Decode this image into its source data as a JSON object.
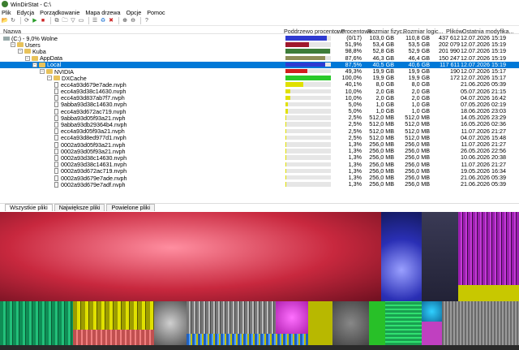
{
  "window": {
    "title": "WinDirStat - C:\\"
  },
  "menu": [
    "Plik",
    "Edycja",
    "Porządkowanie",
    "Mapa drzewa",
    "Opcje",
    "Pomoc"
  ],
  "toolbar_icons": [
    "open-icon",
    "refresh-icon",
    "refresh-all-icon",
    "play-icon",
    "stop-icon",
    "copy-path-icon",
    "explorer-icon",
    "filter-icon",
    "cmd-icon",
    "properties-icon",
    "recycle-icon",
    "delete-icon",
    "zoom-in-icon",
    "zoom-out-icon",
    "help-icon"
  ],
  "columns": {
    "name": "Nazwa",
    "subtree": "Poddrzewo procentowo",
    "percent": "↓ Procentowo",
    "physical": "Rozmiar fizyc...",
    "logical": "Rozmiar logic...",
    "files": "Plików",
    "modified": "Ostatnia modyfika..."
  },
  "rows": [
    {
      "name": "(C:) - 9,0% Wolne",
      "indent": 0,
      "icon": "drive",
      "exp": "",
      "pct": "(0/17)",
      "phys": "103,0 GB",
      "log": "110,8 GB",
      "files": "437 612",
      "date": "12.07.2026 15:19",
      "fill": 0.91,
      "color": "#2f3bd1"
    },
    {
      "name": "Users",
      "indent": 1,
      "icon": "folder",
      "exp": "−",
      "pct": "51,9%",
      "phys": "53,4 GB",
      "log": "53,5 GB",
      "files": "202 079",
      "date": "12.07.2026 15:19",
      "fill": 0.52,
      "color": "#a0192d"
    },
    {
      "name": "Kuba",
      "indent": 2,
      "icon": "folder",
      "exp": "−",
      "pct": "98,8%",
      "phys": "52,8 GB",
      "log": "52,9 GB",
      "files": "201 990",
      "date": "12.07.2026 15:19",
      "fill": 0.99,
      "color": "#3e7d3a"
    },
    {
      "name": "AppData",
      "indent": 3,
      "icon": "folder",
      "exp": "−",
      "pct": "87,6%",
      "phys": "46,3 GB",
      "log": "46,4 GB",
      "files": "150 247",
      "date": "12.07.2026 15:19",
      "fill": 0.88,
      "color": "#8e8e58"
    },
    {
      "name": "Local",
      "indent": 4,
      "icon": "folder",
      "exp": "−",
      "pct": "87,5%",
      "phys": "40,5 GB",
      "log": "40,6 GB",
      "files": "117 611",
      "date": "12.07.2026 15:19",
      "fill": 0.88,
      "color": "#2f3bd1",
      "selected": true
    },
    {
      "name": "NVIDIA",
      "indent": 5,
      "icon": "folder",
      "exp": "−",
      "pct": "49,3%",
      "phys": "19,9 GB",
      "log": "19,9 GB",
      "files": "190",
      "date": "12.07.2026 15:17",
      "fill": 0.49,
      "color": "#d21d1d"
    },
    {
      "name": "DXCache",
      "indent": 6,
      "icon": "folder",
      "exp": "−",
      "pct": "100,0%",
      "phys": "19,9 GB",
      "log": "19,9 GB",
      "files": "172",
      "date": "12.07.2026 15:17",
      "fill": 1.0,
      "color": "#2ac92a"
    },
    {
      "name": "ecc4a93d679e7ade.nvph",
      "indent": 7,
      "icon": "file",
      "exp": "",
      "pct": "40,1%",
      "phys": "8,0 GB",
      "log": "8,0 GB",
      "files": "",
      "date": "21.06.2026 05:39",
      "fill": 0.4,
      "color": "#e0e000"
    },
    {
      "name": "ecc4a93d38c14630.nvph",
      "indent": 7,
      "icon": "file",
      "exp": "",
      "pct": "10,0%",
      "phys": "2,0 GB",
      "log": "2,0 GB",
      "files": "",
      "date": "05.07.2026 21:15",
      "fill": 0.1,
      "color": "#e0e000"
    },
    {
      "name": "ecc4a93d837ab7f7.nvph",
      "indent": 7,
      "icon": "file",
      "exp": "",
      "pct": "10,0%",
      "phys": "2,0 GB",
      "log": "2,0 GB",
      "files": "",
      "date": "04.07.2026 16:42",
      "fill": 0.1,
      "color": "#e0e000"
    },
    {
      "name": "9abba93d38c14630.nvph",
      "indent": 7,
      "icon": "file",
      "exp": "",
      "pct": "5,0%",
      "phys": "1,0 GB",
      "log": "1,0 GB",
      "files": "",
      "date": "07.05.2026 02:19",
      "fill": 0.05,
      "color": "#e0e000"
    },
    {
      "name": "ecc4a93d672ac719.nvph",
      "indent": 7,
      "icon": "file",
      "exp": "",
      "pct": "5,0%",
      "phys": "1,0 GB",
      "log": "1,0 GB",
      "files": "",
      "date": "18.06.2026 23:03",
      "fill": 0.05,
      "color": "#e0e000"
    },
    {
      "name": "9abba93d05f93a21.nvph",
      "indent": 7,
      "icon": "file",
      "exp": "",
      "pct": "2,5%",
      "phys": "512,0 MB",
      "log": "512,0 MB",
      "files": "",
      "date": "14.05.2026 23:29",
      "fill": 0.025,
      "color": "#e0e000"
    },
    {
      "name": "9abba93db29364b4.nvph",
      "indent": 7,
      "icon": "file",
      "exp": "",
      "pct": "2,5%",
      "phys": "512,0 MB",
      "log": "512,0 MB",
      "files": "",
      "date": "16.05.2026 02:36",
      "fill": 0.025,
      "color": "#e0e000"
    },
    {
      "name": "ecc4a93d05f93a21.nvph",
      "indent": 7,
      "icon": "file",
      "exp": "",
      "pct": "2,5%",
      "phys": "512,0 MB",
      "log": "512,0 MB",
      "files": "",
      "date": "11.07.2026 21:27",
      "fill": 0.025,
      "color": "#e0e000"
    },
    {
      "name": "ecc4a93d8ed977d1.nvph",
      "indent": 7,
      "icon": "file",
      "exp": "",
      "pct": "2,5%",
      "phys": "512,0 MB",
      "log": "512,0 MB",
      "files": "",
      "date": "04.07.2026 15:48",
      "fill": 0.025,
      "color": "#e0e000"
    },
    {
      "name": "0002a93d05f93a21.nvph",
      "indent": 7,
      "icon": "file",
      "exp": "",
      "pct": "1,3%",
      "phys": "256,0 MB",
      "log": "256,0 MB",
      "files": "",
      "date": "11.07.2026 21:27",
      "fill": 0.013,
      "color": "#e0e000"
    },
    {
      "name": "0002a93d05f93a21.nvph",
      "indent": 7,
      "icon": "file",
      "exp": "",
      "pct": "1,3%",
      "phys": "256,0 MB",
      "log": "256,0 MB",
      "files": "",
      "date": "26.05.2026 22:56",
      "fill": 0.013,
      "color": "#e0e000"
    },
    {
      "name": "0002a93d38c14630.nvph",
      "indent": 7,
      "icon": "file",
      "exp": "",
      "pct": "1,3%",
      "phys": "256,0 MB",
      "log": "256,0 MB",
      "files": "",
      "date": "10.06.2026 20:38",
      "fill": 0.013,
      "color": "#e0e000"
    },
    {
      "name": "0002a93d38c14631.nvph",
      "indent": 7,
      "icon": "file",
      "exp": "",
      "pct": "1,3%",
      "phys": "256,0 MB",
      "log": "256,0 MB",
      "files": "",
      "date": "11.07.2026 21:27",
      "fill": 0.013,
      "color": "#e0e000"
    },
    {
      "name": "0002a93d672ac719.nvph",
      "indent": 7,
      "icon": "file",
      "exp": "",
      "pct": "1,3%",
      "phys": "256,0 MB",
      "log": "256,0 MB",
      "files": "",
      "date": "19.05.2026 16:34",
      "fill": 0.013,
      "color": "#e0e000"
    },
    {
      "name": "0002a93d679e7ade.nvph",
      "indent": 7,
      "icon": "file",
      "exp": "",
      "pct": "1,3%",
      "phys": "256,0 MB",
      "log": "256,0 MB",
      "files": "",
      "date": "21.06.2026 05:39",
      "fill": 0.013,
      "color": "#e0e000"
    },
    {
      "name": "0002a93d679e7adf.nvph",
      "indent": 7,
      "icon": "file",
      "exp": "",
      "pct": "1,3%",
      "phys": "256,0 MB",
      "log": "256,0 MB",
      "files": "",
      "date": "21.06.2026 05:39",
      "fill": 0.013,
      "color": "#e0e000"
    }
  ],
  "tabs": [
    "Wszystkie pliki",
    "Największe pliki",
    "Powielone pliki"
  ],
  "colors": {
    "selection": "#0078d7"
  }
}
